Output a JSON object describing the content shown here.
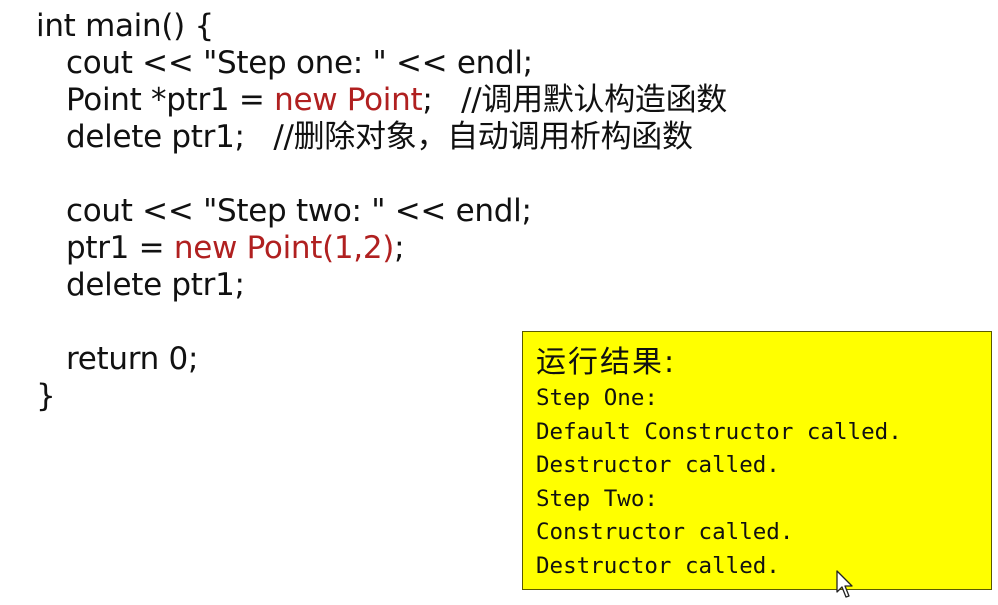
{
  "colors": {
    "accent": "#b02020",
    "box_bg": "#ffff00"
  },
  "code": {
    "line1": "int main() {",
    "line2": "cout << \"Step one: \" << endl;",
    "line3_pre": "Point *ptr1 = ",
    "line3_kw": "new Point",
    "line3_post": ";   //调用默认构造函数",
    "line4": "delete ptr1;   //删除对象，自动调用析构函数",
    "line5": "cout << \"Step two: \" << endl;",
    "line6_pre": "ptr1 = ",
    "line6_kw": "new Point(1,2)",
    "line6_post": ";",
    "line7": "delete ptr1;",
    "line8": "return 0;",
    "line9": "}"
  },
  "output": {
    "title": "运行结果:",
    "lines": [
      "Step One:",
      "Default Constructor called.",
      "Destructor called.",
      "Step Two:",
      "Constructor called.",
      "Destructor called."
    ]
  },
  "icons": {
    "cursor": "mouse-pointer-icon"
  }
}
